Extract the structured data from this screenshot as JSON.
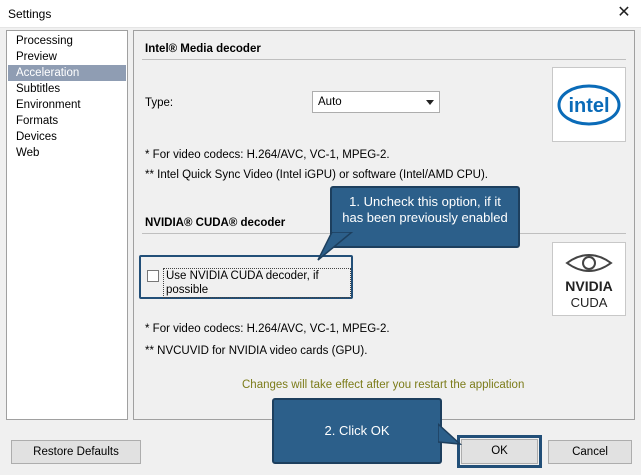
{
  "window": {
    "title": "Settings"
  },
  "sidebar": {
    "items": [
      {
        "label": "Processing"
      },
      {
        "label": "Preview"
      },
      {
        "label": "Acceleration"
      },
      {
        "label": "Subtitles"
      },
      {
        "label": "Environment"
      },
      {
        "label": "Formats"
      },
      {
        "label": "Devices"
      },
      {
        "label": "Web"
      }
    ],
    "selected": "Acceleration"
  },
  "intel": {
    "section_title": "Intel® Media decoder",
    "type_label": "Type:",
    "type_value": "Auto",
    "note1": "*  For video codecs: H.264/AVC, VC-1, MPEG-2.",
    "note2": "** Intel Quick Sync Video (Intel iGPU) or software (Intel/AMD CPU).",
    "logo_text": "intel"
  },
  "nvidia": {
    "section_title": "NVIDIA® CUDA® decoder",
    "checkbox_label": "Use NVIDIA CUDA decoder, if possible",
    "checkbox_checked": false,
    "note1": "*  For video codecs: H.264/AVC, VC-1, MPEG-2.",
    "note2": "** NVCUVID for NVIDIA video cards (GPU).",
    "logo_line1": "NVIDIA",
    "logo_line2": "CUDA"
  },
  "notice": "Changes will take effect after you restart the application",
  "callouts": {
    "step1": "1. Uncheck this option, if it has been previously enabled",
    "step2": "2. Click OK"
  },
  "buttons": {
    "restore": "Restore Defaults",
    "ok": "OK",
    "cancel": "Cancel"
  },
  "colors": {
    "callout_bg": "#2c5f8a",
    "selection": "#8f9db3",
    "notice": "#7c7c1a",
    "highlight_frame": "#224f78"
  }
}
